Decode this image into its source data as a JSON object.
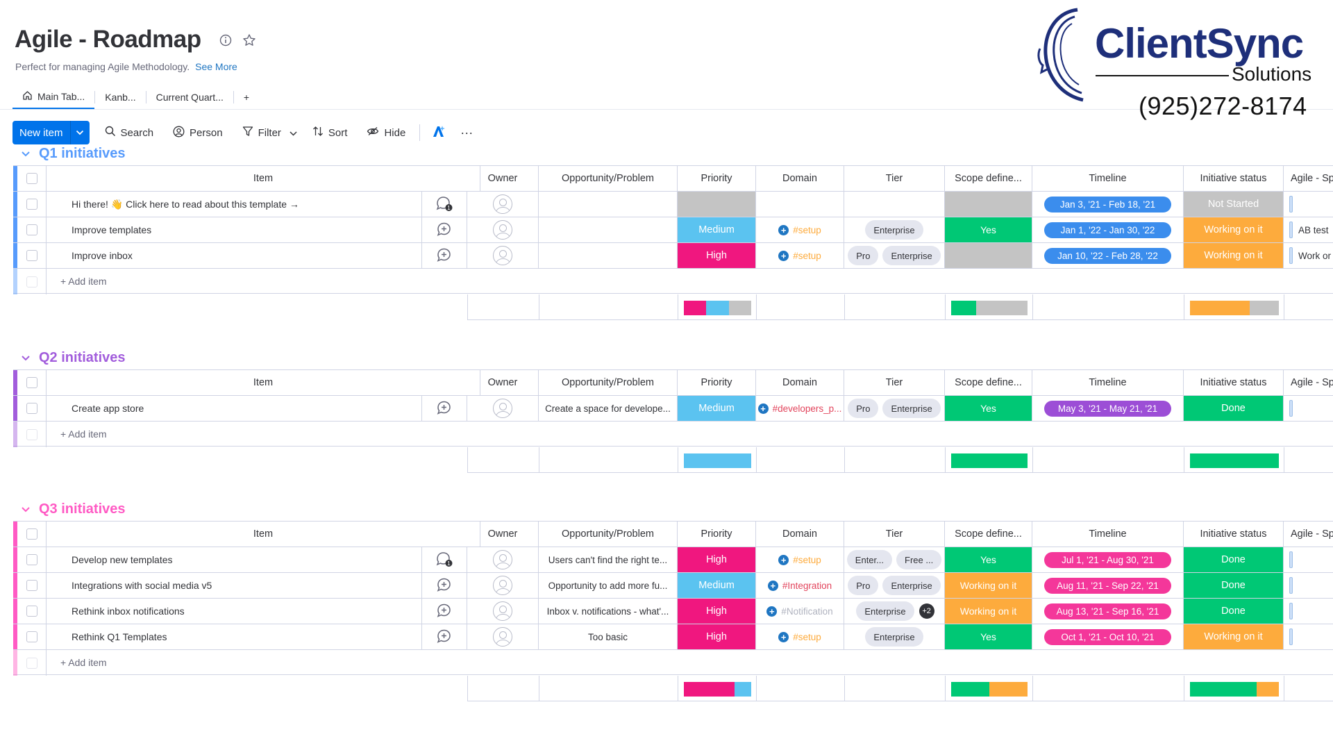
{
  "board": {
    "title": "Agile - Roadmap",
    "description": "Perfect for managing Agile Methodology.",
    "see_more": "See More"
  },
  "tabs": [
    {
      "label": "Main Tab...",
      "icon": "home-icon"
    },
    {
      "label": "Kanb..."
    },
    {
      "label": "Current Quart..."
    },
    {
      "label": "+"
    }
  ],
  "toolbar": {
    "new_item": "New item",
    "search": "Search",
    "person": "Person",
    "filter": "Filter",
    "sort": "Sort",
    "hide": "Hide",
    "more": "···"
  },
  "logo": {
    "name": "ClientSync",
    "tagline": "Solutions",
    "phone": "(925)272-8174"
  },
  "columns": {
    "item": "Item",
    "owner": "Owner",
    "opportunity": "Opportunity/Problem",
    "priority": "Priority",
    "domain": "Domain",
    "tier": "Tier",
    "scope": "Scope define...",
    "timeline": "Timeline",
    "status": "Initiative status",
    "agile": "Agile - Sp"
  },
  "add_item": "+ Add item",
  "colors": {
    "q1": "#579bfc",
    "q2": "#a25ddc",
    "q3": "#ff5ac4",
    "high": "#e2445c",
    "high_pink": "#f0177f",
    "medium": "#5bc3f0",
    "green": "#00c875",
    "orange": "#fdab3d",
    "grey": "#c4c4c4",
    "timeline_blue": "#3b8ded",
    "timeline_purple": "#9c4ed6",
    "timeline_pink": "#f4379a"
  },
  "groups": [
    {
      "id": "q1",
      "title": "Q1 initiatives",
      "rows": [
        {
          "item": "Hi there! 👋 Click here to read about this template →",
          "update_icon": "chat-bubble-count-icon",
          "opportunity": "",
          "priority": "",
          "domain": "",
          "tiers": [],
          "scope": "",
          "timeline": "Jan 3, '21 - Feb 18, '21",
          "status": "Not Started",
          "agile": ""
        },
        {
          "item": "Improve templates",
          "update_icon": "add-update-icon",
          "opportunity": "",
          "priority": "Medium",
          "domain": "#setup",
          "tiers": [
            "Enterprise"
          ],
          "scope": "Yes",
          "timeline": "Jan 1, '22 - Jan 30, '22",
          "status": "Working on it",
          "agile": "AB test"
        },
        {
          "item": "Improve inbox",
          "update_icon": "add-update-icon",
          "opportunity": "",
          "priority": "High",
          "domain": "#setup",
          "tiers": [
            "Pro",
            "Enterprise"
          ],
          "scope": "",
          "timeline": "Jan 10, '22 - Feb 28, '22",
          "status": "Working on it",
          "agile": "Work or"
        }
      ],
      "summary": {
        "priority": [
          {
            "color": "#f0177f",
            "frac": 0.33
          },
          {
            "color": "#5bc3f0",
            "frac": 0.34
          },
          {
            "color": "#c4c4c4",
            "frac": 0.33
          }
        ],
        "scope": [
          {
            "color": "#00c875",
            "frac": 0.33
          },
          {
            "color": "#c4c4c4",
            "frac": 0.67
          }
        ],
        "status": [
          {
            "color": "#fdab3d",
            "frac": 0.67
          },
          {
            "color": "#c4c4c4",
            "frac": 0.33
          }
        ]
      }
    },
    {
      "id": "q2",
      "title": "Q2 initiatives",
      "rows": [
        {
          "item": "Create app store",
          "update_icon": "add-update-icon",
          "opportunity": "Create a space for develope...",
          "priority": "Medium",
          "domain": "#developers_p...",
          "tiers": [
            "Pro",
            "Enterprise"
          ],
          "scope": "Yes",
          "timeline": "May 3, '21 - May 21, '21",
          "status": "Done",
          "agile": ""
        }
      ],
      "summary": {
        "priority": [
          {
            "color": "#5bc3f0",
            "frac": 1
          }
        ],
        "scope": [
          {
            "color": "#00c875",
            "frac": 1
          }
        ],
        "status": [
          {
            "color": "#00c875",
            "frac": 1
          }
        ]
      }
    },
    {
      "id": "q3",
      "title": "Q3 initiatives",
      "rows": [
        {
          "item": "Develop new templates",
          "update_icon": "chat-bubble-count-icon",
          "opportunity": "Users can't find the right te...",
          "priority": "High",
          "domain": "#setup",
          "tiers": [
            "Enter...",
            "Free ..."
          ],
          "scope": "Yes",
          "timeline": "Jul 1, '21 - Aug 30, '21",
          "status": "Done",
          "agile": ""
        },
        {
          "item": "Integrations with social media v5",
          "update_icon": "add-update-icon",
          "opportunity": "Opportunity to add more fu...",
          "priority": "Medium",
          "domain": "#Integration",
          "tiers": [
            "Pro",
            "Enterprise"
          ],
          "scope": "Working on it",
          "timeline": "Aug 11, '21 - Sep 22, '21",
          "status": "Done",
          "agile": ""
        },
        {
          "item": "Rethink inbox notifications",
          "update_icon": "add-update-icon",
          "opportunity": "Inbox v. notifications - what'...",
          "priority": "High",
          "domain": "#Notification",
          "tiers": [
            "Enterprise"
          ],
          "tier_extra": "+2",
          "scope": "Working on it",
          "timeline": "Aug 13, '21 - Sep 16, '21",
          "status": "Done",
          "agile": ""
        },
        {
          "item": "Rethink Q1 Templates",
          "update_icon": "add-update-icon",
          "opportunity": "Too basic",
          "priority": "High",
          "domain": "#setup",
          "tiers": [
            "Enterprise"
          ],
          "scope": "Yes",
          "timeline": "Oct 1, '21 - Oct 10, '21",
          "status": "Working on it",
          "agile": ""
        }
      ],
      "summary": {
        "priority": [
          {
            "color": "#f0177f",
            "frac": 0.75
          },
          {
            "color": "#5bc3f0",
            "frac": 0.25
          }
        ],
        "scope": [
          {
            "color": "#00c875",
            "frac": 0.5
          },
          {
            "color": "#fdab3d",
            "frac": 0.5
          }
        ],
        "status": [
          {
            "color": "#00c875",
            "frac": 0.75
          },
          {
            "color": "#fdab3d",
            "frac": 0.25
          }
        ]
      }
    }
  ]
}
